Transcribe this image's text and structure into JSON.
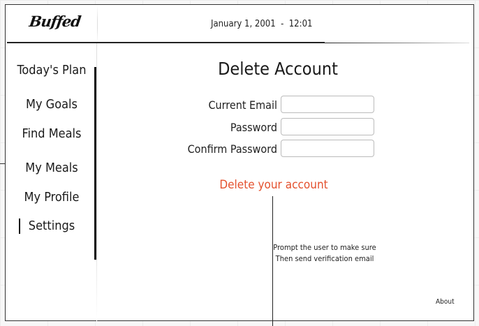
{
  "app": {
    "logo_text": "Buffed"
  },
  "header": {
    "datetime": "January 1, 2001  -  12:01"
  },
  "sidebar": {
    "items": [
      {
        "label": "Today's Plan"
      },
      {
        "label": "My Goals"
      },
      {
        "label": "Find Meals"
      },
      {
        "label": "My Meals"
      },
      {
        "label": "My Profile"
      },
      {
        "label": "Settings",
        "active": true
      }
    ]
  },
  "main": {
    "title": "Delete Account",
    "form": {
      "email_label": "Current Email",
      "email_value": "",
      "password_label": "Password",
      "password_value": "",
      "confirm_label": "Confirm Password",
      "confirm_value": ""
    },
    "delete_link": "Delete your account",
    "note_line1": "Prompt the user to make sure",
    "note_line2": "Then send verification email"
  },
  "footer": {
    "about": "About"
  },
  "colors": {
    "danger": "#e4512e",
    "frame": "#333333"
  }
}
